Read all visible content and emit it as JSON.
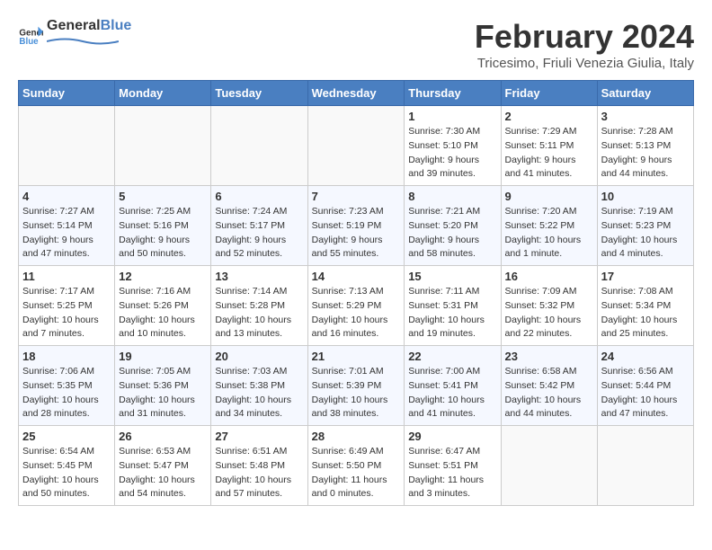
{
  "header": {
    "logo_general": "General",
    "logo_blue": "Blue",
    "month_title": "February 2024",
    "subtitle": "Tricesimo, Friuli Venezia Giulia, Italy"
  },
  "days_of_week": [
    "Sunday",
    "Monday",
    "Tuesday",
    "Wednesday",
    "Thursday",
    "Friday",
    "Saturday"
  ],
  "weeks": [
    [
      {
        "day": "",
        "info": ""
      },
      {
        "day": "",
        "info": ""
      },
      {
        "day": "",
        "info": ""
      },
      {
        "day": "",
        "info": ""
      },
      {
        "day": "1",
        "info": "Sunrise: 7:30 AM\nSunset: 5:10 PM\nDaylight: 9 hours\nand 39 minutes."
      },
      {
        "day": "2",
        "info": "Sunrise: 7:29 AM\nSunset: 5:11 PM\nDaylight: 9 hours\nand 41 minutes."
      },
      {
        "day": "3",
        "info": "Sunrise: 7:28 AM\nSunset: 5:13 PM\nDaylight: 9 hours\nand 44 minutes."
      }
    ],
    [
      {
        "day": "4",
        "info": "Sunrise: 7:27 AM\nSunset: 5:14 PM\nDaylight: 9 hours\nand 47 minutes."
      },
      {
        "day": "5",
        "info": "Sunrise: 7:25 AM\nSunset: 5:16 PM\nDaylight: 9 hours\nand 50 minutes."
      },
      {
        "day": "6",
        "info": "Sunrise: 7:24 AM\nSunset: 5:17 PM\nDaylight: 9 hours\nand 52 minutes."
      },
      {
        "day": "7",
        "info": "Sunrise: 7:23 AM\nSunset: 5:19 PM\nDaylight: 9 hours\nand 55 minutes."
      },
      {
        "day": "8",
        "info": "Sunrise: 7:21 AM\nSunset: 5:20 PM\nDaylight: 9 hours\nand 58 minutes."
      },
      {
        "day": "9",
        "info": "Sunrise: 7:20 AM\nSunset: 5:22 PM\nDaylight: 10 hours\nand 1 minute."
      },
      {
        "day": "10",
        "info": "Sunrise: 7:19 AM\nSunset: 5:23 PM\nDaylight: 10 hours\nand 4 minutes."
      }
    ],
    [
      {
        "day": "11",
        "info": "Sunrise: 7:17 AM\nSunset: 5:25 PM\nDaylight: 10 hours\nand 7 minutes."
      },
      {
        "day": "12",
        "info": "Sunrise: 7:16 AM\nSunset: 5:26 PM\nDaylight: 10 hours\nand 10 minutes."
      },
      {
        "day": "13",
        "info": "Sunrise: 7:14 AM\nSunset: 5:28 PM\nDaylight: 10 hours\nand 13 minutes."
      },
      {
        "day": "14",
        "info": "Sunrise: 7:13 AM\nSunset: 5:29 PM\nDaylight: 10 hours\nand 16 minutes."
      },
      {
        "day": "15",
        "info": "Sunrise: 7:11 AM\nSunset: 5:31 PM\nDaylight: 10 hours\nand 19 minutes."
      },
      {
        "day": "16",
        "info": "Sunrise: 7:09 AM\nSunset: 5:32 PM\nDaylight: 10 hours\nand 22 minutes."
      },
      {
        "day": "17",
        "info": "Sunrise: 7:08 AM\nSunset: 5:34 PM\nDaylight: 10 hours\nand 25 minutes."
      }
    ],
    [
      {
        "day": "18",
        "info": "Sunrise: 7:06 AM\nSunset: 5:35 PM\nDaylight: 10 hours\nand 28 minutes."
      },
      {
        "day": "19",
        "info": "Sunrise: 7:05 AM\nSunset: 5:36 PM\nDaylight: 10 hours\nand 31 minutes."
      },
      {
        "day": "20",
        "info": "Sunrise: 7:03 AM\nSunset: 5:38 PM\nDaylight: 10 hours\nand 34 minutes."
      },
      {
        "day": "21",
        "info": "Sunrise: 7:01 AM\nSunset: 5:39 PM\nDaylight: 10 hours\nand 38 minutes."
      },
      {
        "day": "22",
        "info": "Sunrise: 7:00 AM\nSunset: 5:41 PM\nDaylight: 10 hours\nand 41 minutes."
      },
      {
        "day": "23",
        "info": "Sunrise: 6:58 AM\nSunset: 5:42 PM\nDaylight: 10 hours\nand 44 minutes."
      },
      {
        "day": "24",
        "info": "Sunrise: 6:56 AM\nSunset: 5:44 PM\nDaylight: 10 hours\nand 47 minutes."
      }
    ],
    [
      {
        "day": "25",
        "info": "Sunrise: 6:54 AM\nSunset: 5:45 PM\nDaylight: 10 hours\nand 50 minutes."
      },
      {
        "day": "26",
        "info": "Sunrise: 6:53 AM\nSunset: 5:47 PM\nDaylight: 10 hours\nand 54 minutes."
      },
      {
        "day": "27",
        "info": "Sunrise: 6:51 AM\nSunset: 5:48 PM\nDaylight: 10 hours\nand 57 minutes."
      },
      {
        "day": "28",
        "info": "Sunrise: 6:49 AM\nSunset: 5:50 PM\nDaylight: 11 hours\nand 0 minutes."
      },
      {
        "day": "29",
        "info": "Sunrise: 6:47 AM\nSunset: 5:51 PM\nDaylight: 11 hours\nand 3 minutes."
      },
      {
        "day": "",
        "info": ""
      },
      {
        "day": "",
        "info": ""
      }
    ]
  ]
}
